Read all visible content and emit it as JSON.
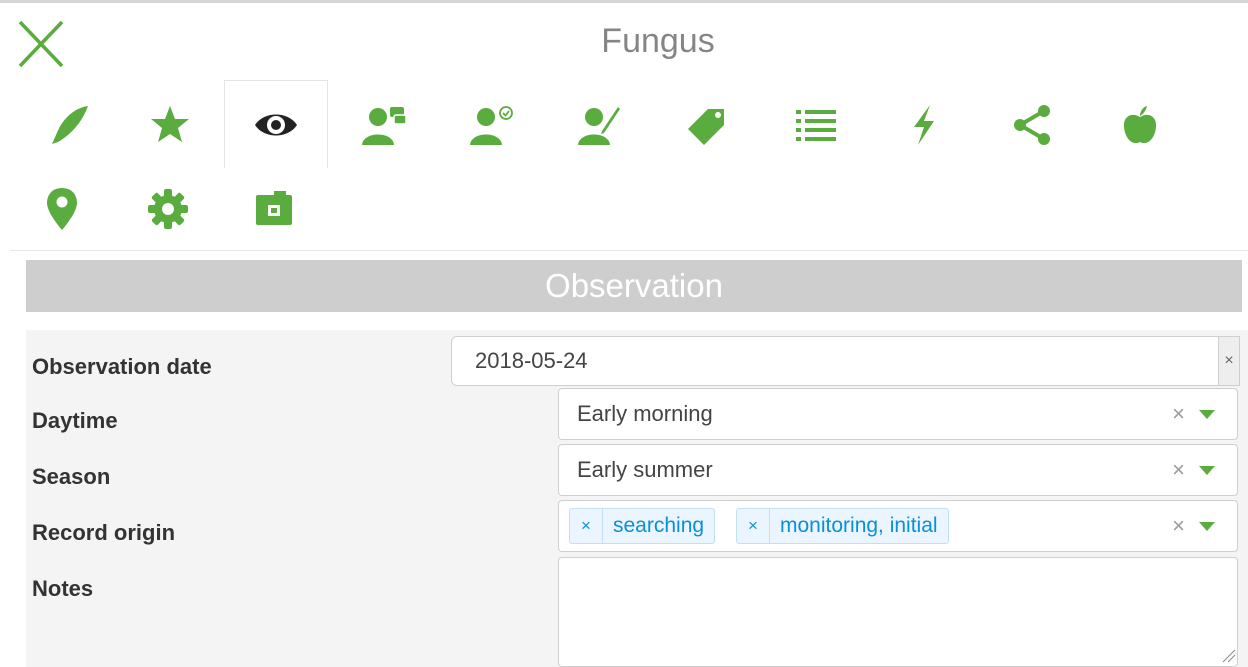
{
  "app": {
    "title": "Fungus",
    "close_icon": "close-x-icon",
    "accent_color": "#5aac3e"
  },
  "tabs": [
    {
      "icon": "feather-icon",
      "active": false
    },
    {
      "icon": "star-icon",
      "active": false
    },
    {
      "icon": "eye-icon",
      "active": true
    },
    {
      "icon": "user-chat-icon",
      "active": false
    },
    {
      "icon": "user-check-icon",
      "active": false
    },
    {
      "icon": "user-edit-icon",
      "active": false
    },
    {
      "icon": "tag-icon",
      "active": false
    },
    {
      "icon": "list-icon",
      "active": false
    },
    {
      "icon": "lightning-icon",
      "active": false
    },
    {
      "icon": "share-icon",
      "active": false
    },
    {
      "icon": "apple-icon",
      "active": false
    },
    {
      "icon": "map-marker-icon",
      "active": false
    },
    {
      "icon": "gear-icon",
      "active": false
    },
    {
      "icon": "camera-icon",
      "active": false
    }
  ],
  "section": {
    "title": "Observation"
  },
  "form": {
    "observation_date": {
      "label": "Observation date",
      "value": "2018-05-24",
      "clear": "×"
    },
    "daytime": {
      "label": "Daytime",
      "value": "Early morning",
      "clear": "×"
    },
    "season": {
      "label": "Season",
      "value": "Early summer",
      "clear": "×"
    },
    "record_origin": {
      "label": "Record origin",
      "chips": [
        {
          "remove": "×",
          "label": "searching"
        },
        {
          "remove": "×",
          "label": "monitoring, initial"
        }
      ],
      "clear": "×"
    },
    "notes": {
      "label": "Notes",
      "value": ""
    }
  }
}
